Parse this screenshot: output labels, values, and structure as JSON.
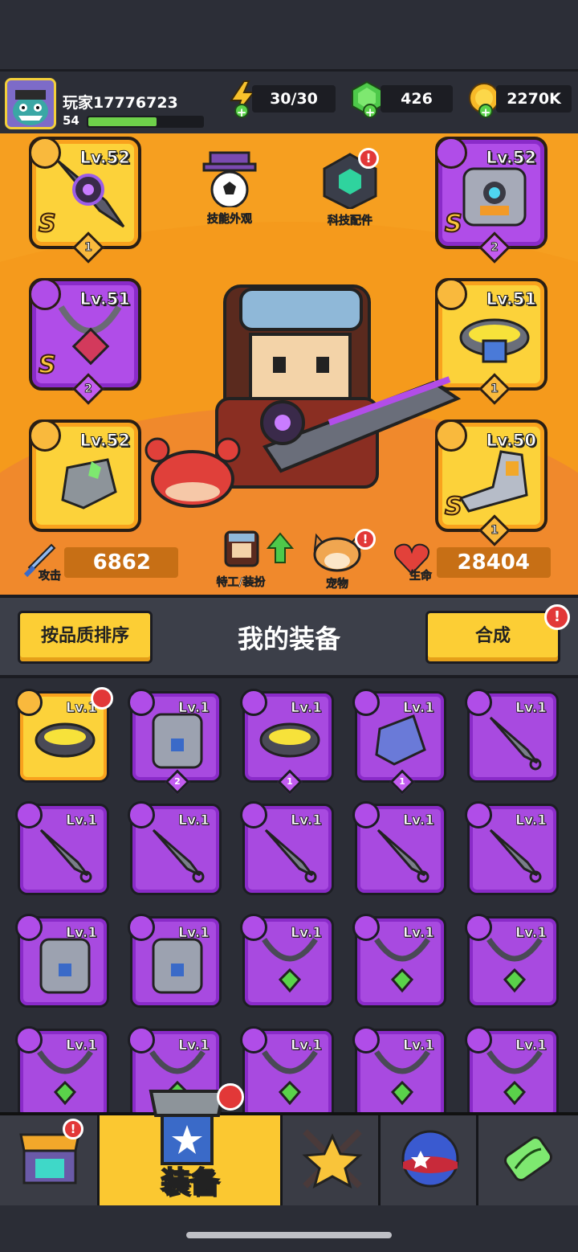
{
  "header": {
    "player_name": "玩家17776723",
    "player_level": "54",
    "xp_fraction": 0.6,
    "energy": "30/30",
    "gems": "426",
    "coins": "2270K"
  },
  "hero": {
    "left_slots": [
      {
        "level": "Lv.52",
        "grade": "S",
        "stars": "1",
        "type": "weapon",
        "frame": "gold"
      },
      {
        "level": "Lv.51",
        "grade": "S",
        "stars": "2",
        "type": "necklace",
        "frame": "purple"
      },
      {
        "level": "Lv.52",
        "grade": "",
        "stars": "",
        "type": "glove",
        "frame": "gold"
      }
    ],
    "right_slots": [
      {
        "level": "Lv.52",
        "grade": "S",
        "stars": "2",
        "type": "armor",
        "frame": "purple"
      },
      {
        "level": "Lv.51",
        "grade": "",
        "stars": "1",
        "type": "belt",
        "frame": "gold"
      },
      {
        "level": "Lv.50",
        "grade": "S",
        "stars": "1",
        "type": "boots",
        "frame": "gold"
      }
    ],
    "skill_skin_label": "技能外观",
    "tech_parts_label": "科技配件",
    "agent_label": "特工/装扮",
    "pet_label": "宠物",
    "attack_label": "攻击",
    "attack_value": "6862",
    "hp_label": "生命",
    "hp_value": "28404"
  },
  "panel": {
    "sort_label": "按品质排序",
    "title": "我的装备",
    "merge_label": "合成"
  },
  "inventory": [
    {
      "level": "Lv.1",
      "type": "belt",
      "frame": "gold",
      "stars": "",
      "badge": true
    },
    {
      "level": "Lv.1",
      "type": "armor",
      "frame": "purple",
      "stars": "2",
      "badge": false
    },
    {
      "level": "Lv.1",
      "type": "belt",
      "frame": "purple",
      "stars": "1",
      "badge": false
    },
    {
      "level": "Lv.1",
      "type": "glove",
      "frame": "purple",
      "stars": "1",
      "badge": false
    },
    {
      "level": "Lv.1",
      "type": "weapon",
      "frame": "purple",
      "stars": "",
      "badge": false
    },
    {
      "level": "Lv.1",
      "type": "weapon",
      "frame": "purple",
      "stars": "",
      "badge": false
    },
    {
      "level": "Lv.1",
      "type": "weapon",
      "frame": "purple",
      "stars": "",
      "badge": false
    },
    {
      "level": "Lv.1",
      "type": "weapon",
      "frame": "purple",
      "stars": "",
      "badge": false
    },
    {
      "level": "Lv.1",
      "type": "weapon",
      "frame": "purple",
      "stars": "",
      "badge": false
    },
    {
      "level": "Lv.1",
      "type": "weapon",
      "frame": "purple",
      "stars": "",
      "badge": false
    },
    {
      "level": "Lv.1",
      "type": "armor",
      "frame": "purple",
      "stars": "",
      "badge": false
    },
    {
      "level": "Lv.1",
      "type": "armor",
      "frame": "purple",
      "stars": "",
      "badge": false
    },
    {
      "level": "Lv.1",
      "type": "necklace",
      "frame": "purple",
      "stars": "",
      "badge": false
    },
    {
      "level": "Lv.1",
      "type": "necklace",
      "frame": "purple",
      "stars": "",
      "badge": false
    },
    {
      "level": "Lv.1",
      "type": "necklace",
      "frame": "purple",
      "stars": "",
      "badge": false
    },
    {
      "level": "Lv.1",
      "type": "necklace",
      "frame": "purple",
      "stars": "",
      "badge": false
    },
    {
      "level": "Lv.1",
      "type": "necklace",
      "frame": "purple",
      "stars": "",
      "badge": false
    },
    {
      "level": "Lv.1",
      "type": "necklace",
      "frame": "purple",
      "stars": "",
      "badge": false
    },
    {
      "level": "Lv.1",
      "type": "necklace",
      "frame": "purple",
      "stars": "",
      "badge": false
    },
    {
      "level": "Lv.1",
      "type": "necklace",
      "frame": "purple",
      "stars": "",
      "badge": false
    }
  ],
  "nav": {
    "active_label": "装备",
    "tabs": [
      "shop-icon",
      "equipment-icon",
      "star-swords-icon",
      "gacha-ball-icon",
      "dna-capsule-icon"
    ]
  },
  "colors": {
    "gold_frame": "#fcd23a",
    "purple_frame": "#a84ae0",
    "hero_bg": "#f59a1c",
    "alert_red": "#e23838",
    "xp_green": "#6ed04a"
  }
}
